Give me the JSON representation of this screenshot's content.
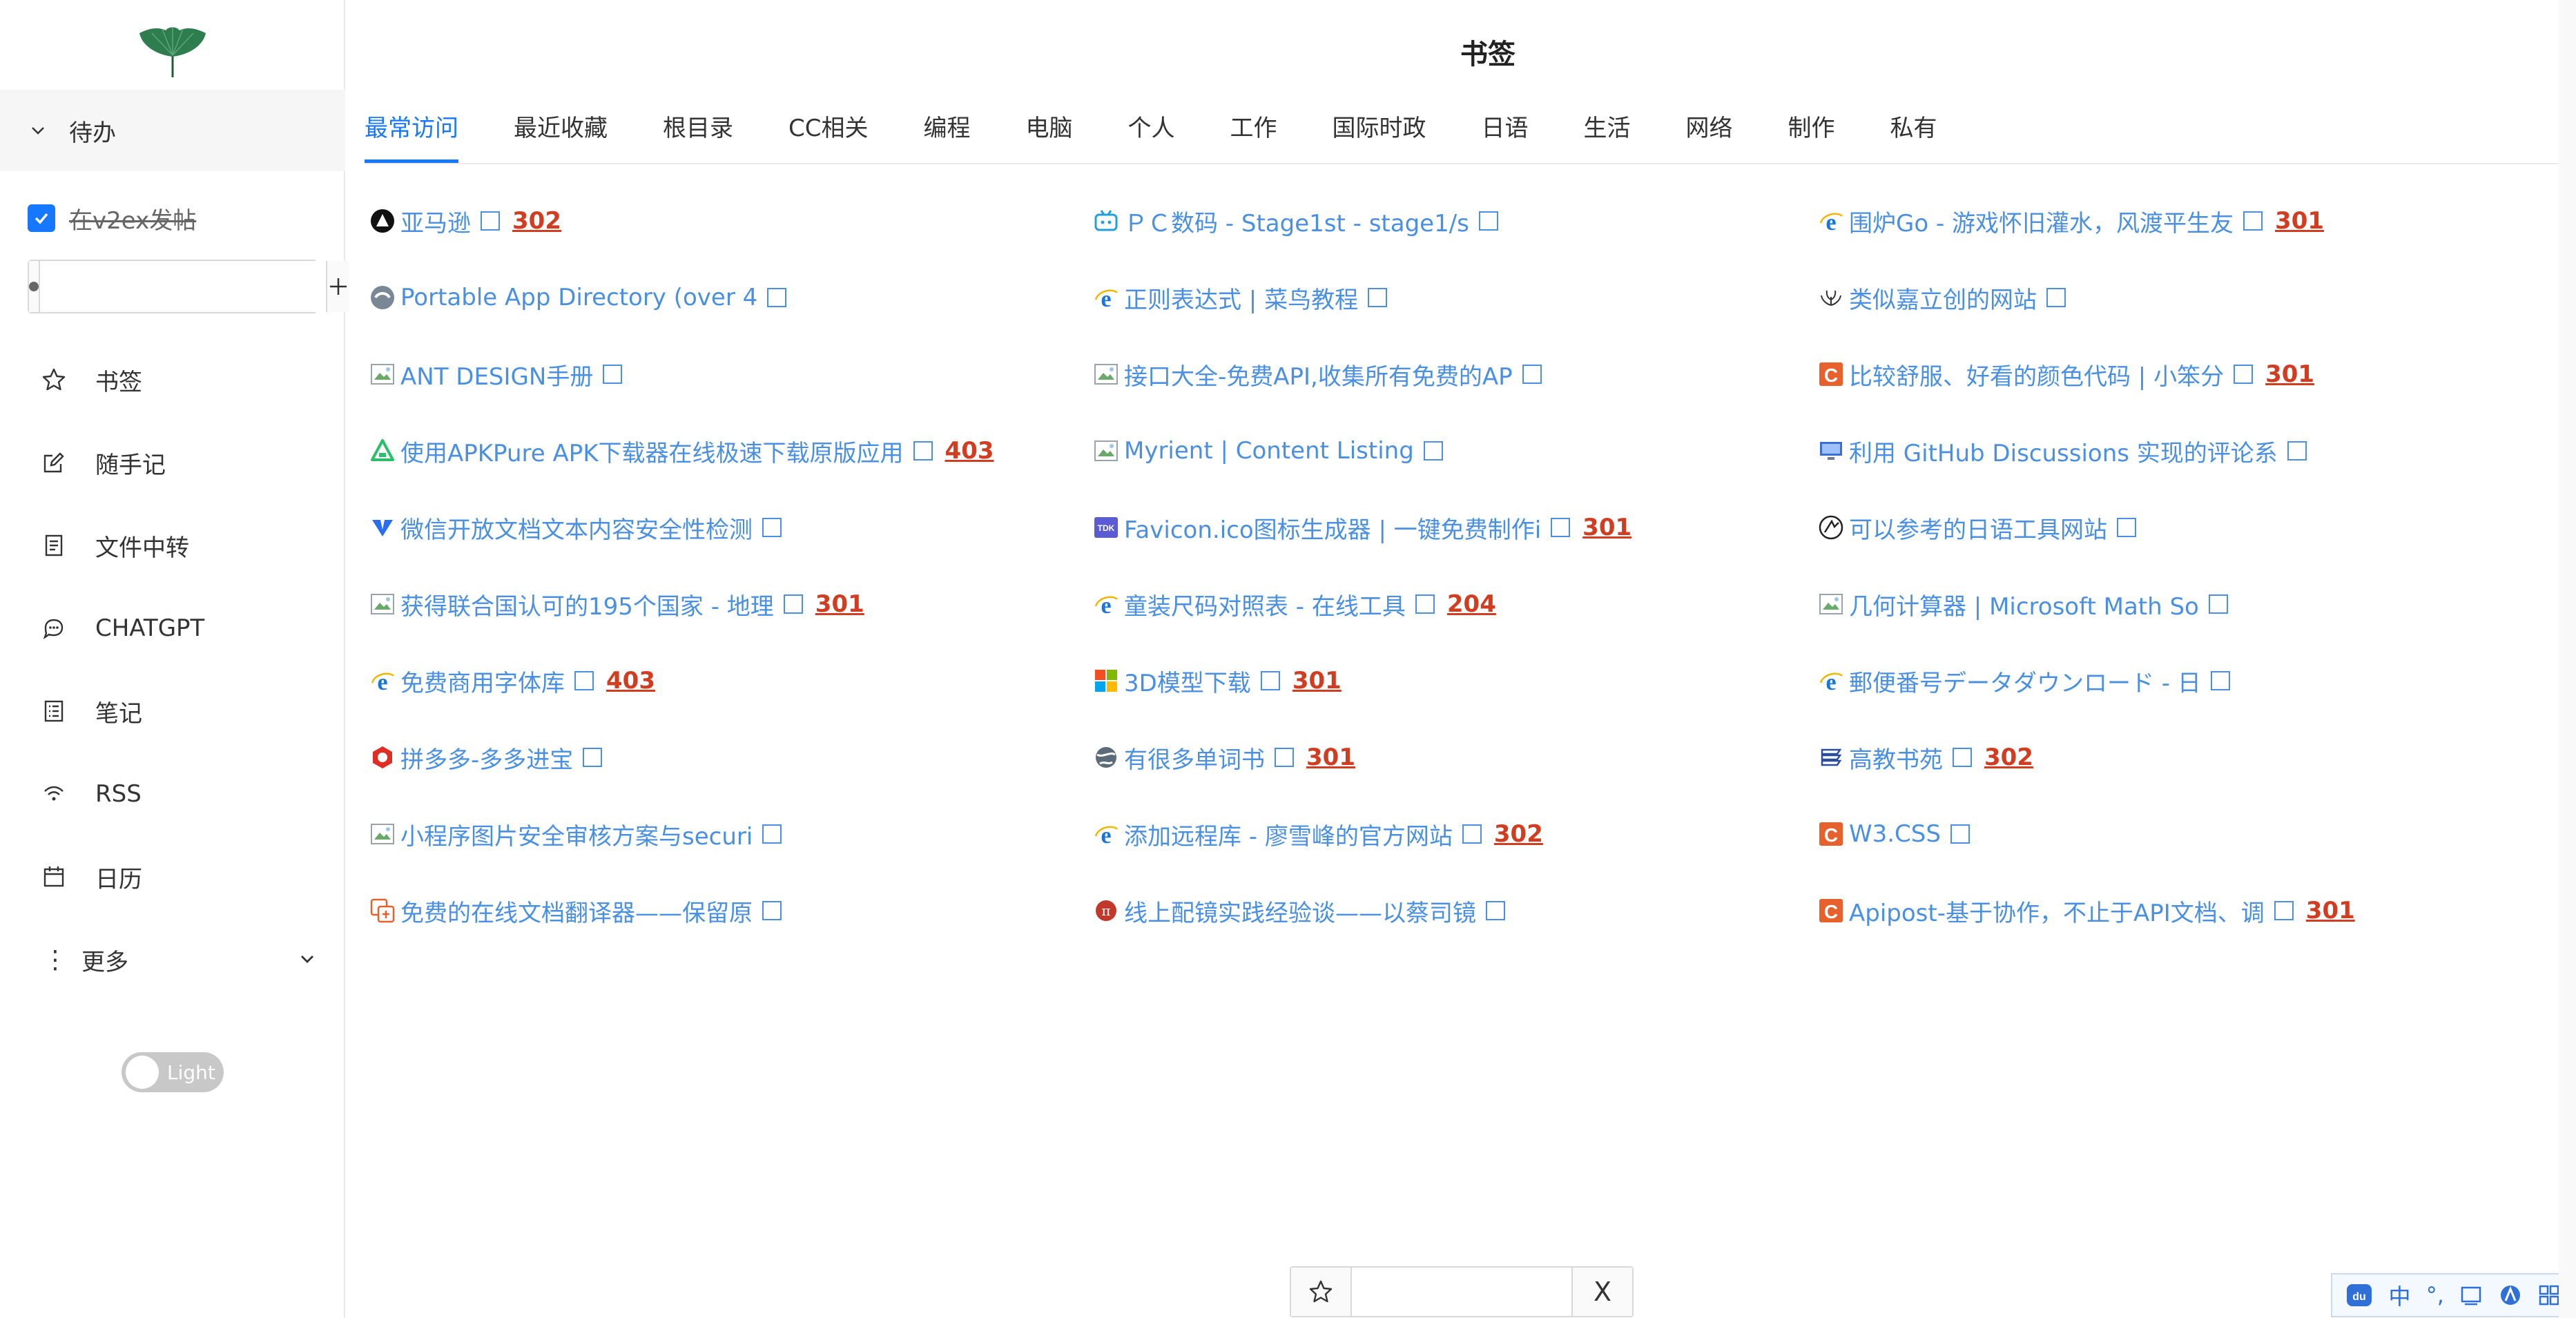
{
  "sidebar": {
    "todo_section": "待办",
    "todo_items": [
      {
        "text": "在v2ex发帖",
        "checked": true
      }
    ],
    "menu": [
      {
        "label": "书签",
        "icon": "star-icon"
      },
      {
        "label": "随手记",
        "icon": "edit-icon"
      },
      {
        "label": "文件中转",
        "icon": "file-icon"
      },
      {
        "label": "CHATGPT",
        "icon": "chat-icon"
      },
      {
        "label": "笔记",
        "icon": "notebook-icon"
      },
      {
        "label": "RSS",
        "icon": "rss-icon"
      },
      {
        "label": "日历",
        "icon": "calendar-icon"
      }
    ],
    "more_label": "更多",
    "theme_label": "Light"
  },
  "main": {
    "title": "书签",
    "tabs": [
      "最常访问",
      "最近收藏",
      "根目录",
      "CC相关",
      "编程",
      "电脑",
      "个人",
      "工作",
      "国际时政",
      "日语",
      "生活",
      "网络",
      "制作",
      "私有"
    ],
    "active_tab": "最常访问",
    "bookmarks": [
      [
        {
          "title": "亚马逊",
          "code": "302",
          "icon": "amazon-icon"
        },
        {
          "title": "ＰＣ数码 - Stage1st - stage1/s",
          "code": "",
          "icon": "bilibili-icon"
        },
        {
          "title": "围炉Go - 游戏怀旧灌水，风渡平生友",
          "code": "301",
          "icon": "ie-icon"
        }
      ],
      [
        {
          "title": "Portable App Directory (over 4",
          "code": "",
          "icon": "portable-icon"
        },
        {
          "title": "正则表达式 | 菜鸟教程",
          "code": "",
          "icon": "ie-icon"
        },
        {
          "title": "类似嘉立创的网站",
          "code": "",
          "icon": "leaf-icon"
        }
      ],
      [
        {
          "title": "ANT DESIGN手册",
          "code": "",
          "icon": "image-icon"
        },
        {
          "title": "接口大全-免费API,收集所有免费的AP",
          "code": "",
          "icon": "image-icon"
        },
        {
          "title": "比较舒服、好看的颜色代码 | 小笨分",
          "code": "301",
          "icon": "c-icon"
        }
      ],
      [
        {
          "title": "使用APKPure APK下载器在线极速下载原版应用",
          "code": "403",
          "icon": "apkpure-icon"
        },
        {
          "title": "Myrient | Content Listing",
          "code": "",
          "icon": "image-icon"
        },
        {
          "title": "利用 GitHub Discussions 实现的评论系",
          "code": "",
          "icon": "monitor-icon"
        }
      ],
      [
        {
          "title": "微信开放文档文本内容安全性检测",
          "code": "",
          "icon": "wechat-icon"
        },
        {
          "title": "Favicon.ico图标生成器 | 一键免费制作i",
          "code": "301",
          "icon": "tdk-icon"
        },
        {
          "title": "可以参考的日语工具网站",
          "code": "",
          "icon": "circle-logo-icon"
        }
      ],
      [
        {
          "title": "获得联合国认可的195个国家 - 地理",
          "code": "301",
          "icon": "image-icon"
        },
        {
          "title": "童装尺码对照表 - 在线工具",
          "code": "204",
          "icon": "ie-icon"
        },
        {
          "title": "几何计算器 | Microsoft Math So",
          "code": "",
          "icon": "image-icon"
        }
      ],
      [
        {
          "title": "免费商用字体库",
          "code": "403",
          "icon": "ie-icon"
        },
        {
          "title": "3D模型下载",
          "code": "301",
          "icon": "windows-icon"
        },
        {
          "title": "郵便番号データダウンロード - 日",
          "code": "",
          "icon": "ie-icon"
        }
      ],
      [
        {
          "title": "拼多多-多多进宝",
          "code": "",
          "icon": "pinduoduo-icon"
        },
        {
          "title": "有很多单词书",
          "code": "301",
          "icon": "globe-icon"
        },
        {
          "title": "高教书苑",
          "code": "302",
          "icon": "books-icon"
        }
      ],
      [
        {
          "title": "小程序图片安全审核方案与securi",
          "code": "",
          "icon": "image-icon"
        },
        {
          "title": "添加远程库 - 廖雪峰的官方网站",
          "code": "302",
          "icon": "ie-icon"
        },
        {
          "title": "W3.CSS",
          "code": "",
          "icon": "c-icon"
        }
      ],
      [
        {
          "title": "免费的在线文档翻译器——保留原",
          "code": "",
          "icon": "translate-icon"
        },
        {
          "title": "线上配镜实践经验谈——以蔡司镜",
          "code": "",
          "icon": "pi-icon"
        },
        {
          "title": "Apipost-基于协作，不止于API文档、调",
          "code": "301",
          "icon": "c-icon"
        }
      ]
    ]
  },
  "quickbar": {
    "close_label": "X"
  },
  "ime": {
    "items": [
      "中",
      "°,"
    ]
  },
  "colors": {
    "accent": "#1677ff",
    "link": "#4a90e2",
    "code": "#d03d20"
  }
}
